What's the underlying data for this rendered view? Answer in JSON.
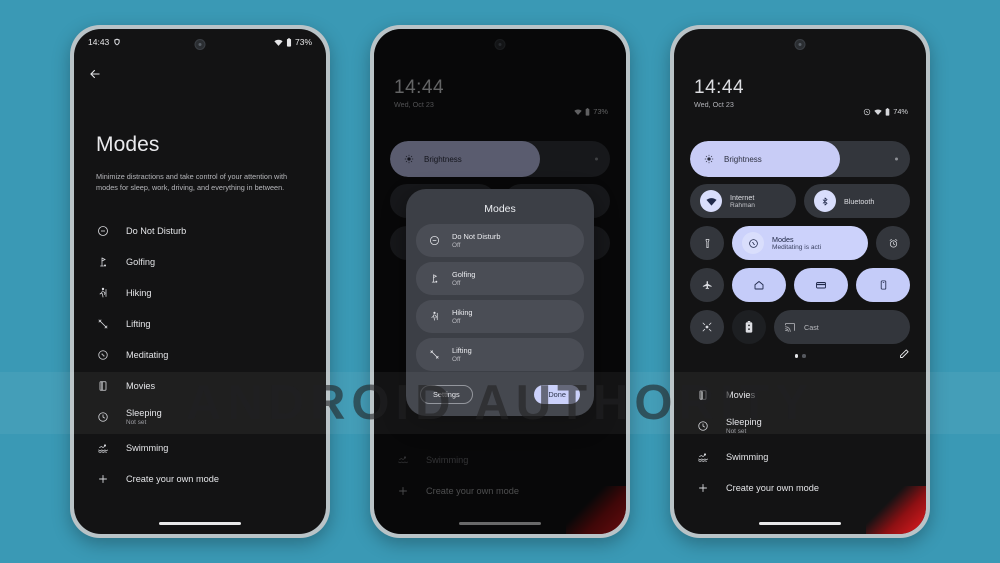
{
  "background_color": "#3a99b5",
  "watermark": {
    "text": "ANDROID AUTHORITY"
  },
  "phone1": {
    "status_bar": {
      "time": "14:43",
      "battery": "73%",
      "dnd_icon": "dnd-shield-icon",
      "wifi_icon": "wifi-icon",
      "battery_icon": "battery-icon"
    },
    "back_icon": "back-arrow-icon",
    "title": "Modes",
    "description": "Minimize distractions and take control of your attention with modes for sleep, work, driving, and everything in between.",
    "modes": [
      {
        "name": "Do Not Disturb",
        "sub": "",
        "icon": "do-not-disturb-icon"
      },
      {
        "name": "Golfing",
        "sub": "",
        "icon": "golf-icon"
      },
      {
        "name": "Hiking",
        "sub": "",
        "icon": "hiking-icon"
      },
      {
        "name": "Lifting",
        "sub": "",
        "icon": "dumbbell-icon"
      },
      {
        "name": "Meditating",
        "sub": "",
        "icon": "meditation-icon"
      },
      {
        "name": "Movies",
        "sub": "",
        "icon": "movie-icon"
      },
      {
        "name": "Sleeping",
        "sub": "Not set",
        "icon": "clock-icon"
      },
      {
        "name": "Swimming",
        "sub": "",
        "icon": "swimming-icon"
      },
      {
        "name": "Create your own mode",
        "sub": "",
        "icon": "plus-icon"
      }
    ]
  },
  "phone2": {
    "status": {
      "time": "14:44",
      "date": "Wed, Oct 23",
      "battery": "73%"
    },
    "brightness": {
      "label": "Brightness",
      "level": 68
    },
    "dialog": {
      "title": "Modes",
      "rows": [
        {
          "name": "Do Not Disturb",
          "state": "Off",
          "icon": "do-not-disturb-icon"
        },
        {
          "name": "Golfing",
          "state": "Off",
          "icon": "golf-icon"
        },
        {
          "name": "Hiking",
          "state": "Off",
          "icon": "hiking-icon"
        },
        {
          "name": "Lifting",
          "state": "Off",
          "icon": "dumbbell-icon"
        }
      ],
      "settings_button": "Settings",
      "done_button": "Done"
    },
    "below": {
      "create_label": "Create your own mode",
      "swimming_label": "Swimming"
    }
  },
  "phone3": {
    "status": {
      "time": "14:44",
      "date": "Wed, Oct 23",
      "battery": "74%"
    },
    "brightness": {
      "label": "Brightness",
      "level": 68
    },
    "tiles": {
      "internet": {
        "title": "Internet",
        "sub": "Rahman",
        "icon": "wifi-icon"
      },
      "bluetooth": {
        "title": "Bluetooth",
        "icon": "bluetooth-icon"
      },
      "flashlight": {
        "icon": "flashlight-icon"
      },
      "modes": {
        "title": "Modes",
        "sub": "Meditating is acti",
        "icon": "meditation-icon"
      },
      "alarm": {
        "icon": "alarm-icon"
      },
      "airplane": {
        "icon": "airplane-icon"
      },
      "home": {
        "icon": "home-icon"
      },
      "wallet": {
        "icon": "wallet-icon"
      },
      "device": {
        "icon": "device-icon"
      },
      "hotspot": {
        "icon": "hotspot-off-icon"
      },
      "battery_saver": {
        "icon": "battery-saver-icon"
      },
      "cast": {
        "title": "Cast",
        "icon": "cast-icon"
      }
    },
    "edit_icon": "pencil-edit-icon",
    "modes": [
      {
        "name": "Movies",
        "sub": "",
        "icon": "movie-icon"
      },
      {
        "name": "Sleeping",
        "sub": "Not set",
        "icon": "clock-icon"
      },
      {
        "name": "Swimming",
        "sub": "",
        "icon": "swimming-icon"
      },
      {
        "name": "Create your own mode",
        "sub": "",
        "icon": "plus-icon"
      }
    ]
  }
}
